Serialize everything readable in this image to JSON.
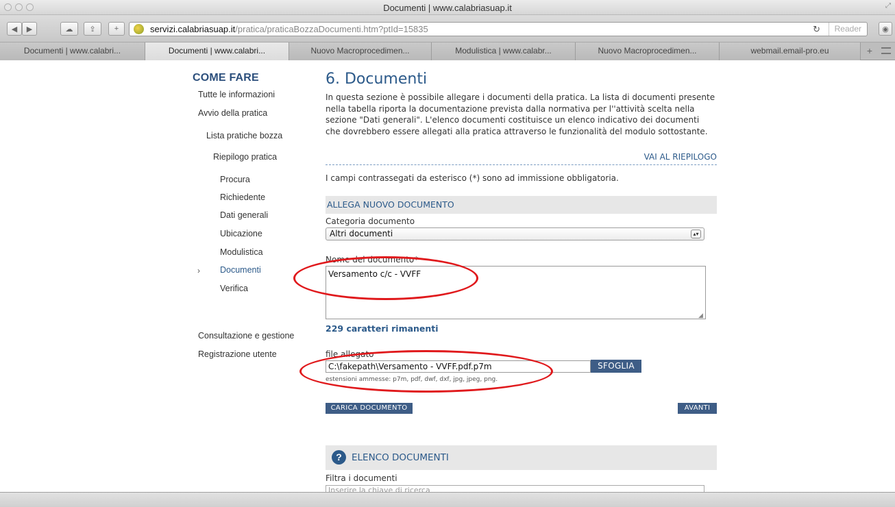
{
  "window": {
    "title": "Documenti | www.calabriasuap.it"
  },
  "toolbar": {
    "address_host": "servizi.calabriasuap.it",
    "address_path": "/pratica/praticaBozzaDocumenti.htm?ptId=15835",
    "reader_label": "Reader"
  },
  "tabs": [
    {
      "label": "Documenti | www.calabri...",
      "active": false
    },
    {
      "label": "Documenti | www.calabri...",
      "active": true
    },
    {
      "label": "Nuovo Macroprocedimen...",
      "active": false
    },
    {
      "label": "Modulistica | www.calabr...",
      "active": false
    },
    {
      "label": "Nuovo Macroprocedimen...",
      "active": false
    },
    {
      "label": "webmail.email-pro.eu",
      "active": false
    }
  ],
  "sidebar": {
    "title": "COME FARE",
    "items": [
      {
        "label": "Tutte le informazioni"
      },
      {
        "label": "Avvio della pratica"
      },
      {
        "label": "Lista pratiche bozza"
      },
      {
        "label": "Riepilogo pratica"
      },
      {
        "label": "Procura"
      },
      {
        "label": "Richiedente"
      },
      {
        "label": "Dati generali"
      },
      {
        "label": "Ubicazione"
      },
      {
        "label": "Modulistica"
      },
      {
        "label": "Documenti",
        "current": true
      },
      {
        "label": "Verifica"
      },
      {
        "label": "Consultazione e gestione"
      },
      {
        "label": "Registrazione utente"
      }
    ],
    "current_marker": "›"
  },
  "main": {
    "title": "6. Documenti",
    "intro": "In questa sezione è possibile allegare i documenti della pratica. La lista di documenti presente nella tabella riporta la documentazione prevista dalla normativa per l''attività scelta nella sezione \"Dati generali\". L'elenco documenti costituisce un elenco indicativo dei documenti che dovrebbero essere allegati alla pratica attraverso le funzionalità del modulo sottostante.",
    "summary_link": "VAI AL RIEPILOGO",
    "required_note": "I campi contrassegati da esterisco (*) sono ad immissione obbligatoria.",
    "new_doc_section": "ALLEGA NUOVO DOCUMENTO",
    "category_label": "Categoria documento",
    "category_value": "Altri documenti",
    "name_label": "Nome del documento*",
    "name_value": "Versamento c/c - VVFF",
    "chars_remaining": "229 caratteri rimanenti",
    "file_label": "file allegato",
    "file_value": "C:\\fakepath\\Versamento - VVFF.pdf.p7m",
    "browse_label": "SFOGLIA",
    "extensions_note": "estensioni ammesse: p7m, pdf, dwf, dxf, jpg, jpeg, png.",
    "upload_label": "CARICA DOCUMENTO",
    "next_label": "AVANTI",
    "doc_list_title": "ELENCO DOCUMENTI",
    "filter_label": "Filtra i documenti",
    "filter_placeholder": "Inserire la chiave di ricerca"
  },
  "colors": {
    "accent": "#2c5a8a",
    "button": "#3e5d86",
    "annotation": "#e0191c"
  },
  "icons": {
    "help": "question-circle-icon"
  }
}
